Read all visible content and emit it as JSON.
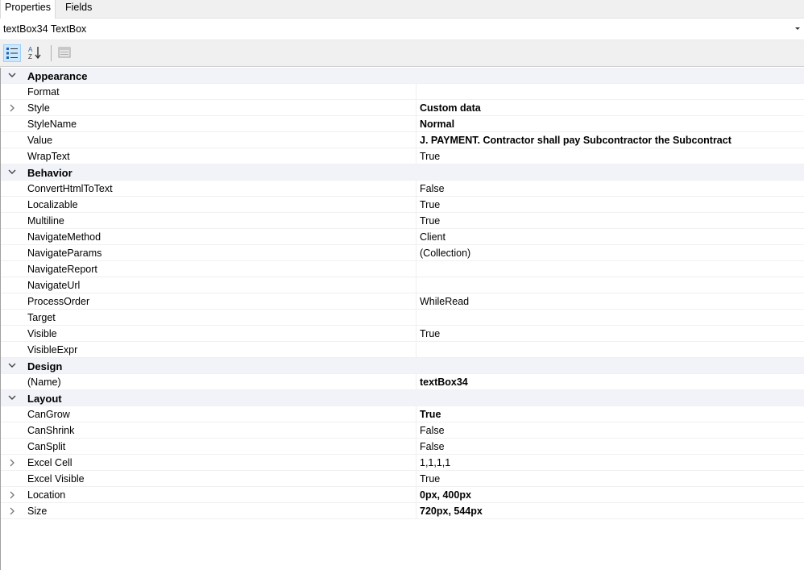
{
  "tabs": [
    "Properties",
    "Fields"
  ],
  "object_selector": {
    "value": "textBox34  TextBox",
    "icon": "chevron-down-icon"
  },
  "toolbar": {
    "buttons": [
      "categorized-icon",
      "alphabetical-sort-icon",
      "property-pages-icon"
    ]
  },
  "grid": {
    "categories": [
      {
        "label": "Appearance",
        "rows": [
          {
            "name": "Format",
            "value": "",
            "bold": false,
            "expandable": false
          },
          {
            "name": "Style",
            "value": "Custom data",
            "bold": true,
            "expandable": true
          },
          {
            "name": "StyleName",
            "value": "Normal",
            "bold": true,
            "expandable": false
          },
          {
            "name": "Value",
            "value": "J.  PAYMENT.  Contractor shall pay Subcontractor the Subcontract",
            "bold": true,
            "expandable": false
          },
          {
            "name": "WrapText",
            "value": "True",
            "bold": false,
            "expandable": false
          }
        ]
      },
      {
        "label": "Behavior",
        "rows": [
          {
            "name": "ConvertHtmlToText",
            "value": "False",
            "bold": false,
            "expandable": false
          },
          {
            "name": "Localizable",
            "value": "True",
            "bold": false,
            "expandable": false
          },
          {
            "name": "Multiline",
            "value": "True",
            "bold": false,
            "expandable": false
          },
          {
            "name": "NavigateMethod",
            "value": "Client",
            "bold": false,
            "expandable": false
          },
          {
            "name": "NavigateParams",
            "value": "(Collection)",
            "bold": false,
            "expandable": false
          },
          {
            "name": "NavigateReport",
            "value": "",
            "bold": false,
            "expandable": false
          },
          {
            "name": "NavigateUrl",
            "value": "",
            "bold": false,
            "expandable": false
          },
          {
            "name": "ProcessOrder",
            "value": "WhileRead",
            "bold": false,
            "expandable": false
          },
          {
            "name": "Target",
            "value": "",
            "bold": false,
            "expandable": false
          },
          {
            "name": "Visible",
            "value": "True",
            "bold": false,
            "expandable": false
          },
          {
            "name": "VisibleExpr",
            "value": "",
            "bold": false,
            "expandable": false
          }
        ]
      },
      {
        "label": "Design",
        "rows": [
          {
            "name": "(Name)",
            "value": "textBox34",
            "bold": true,
            "expandable": false
          }
        ]
      },
      {
        "label": "Layout",
        "rows": [
          {
            "name": "CanGrow",
            "value": "True",
            "bold": true,
            "expandable": false
          },
          {
            "name": "CanShrink",
            "value": "False",
            "bold": false,
            "expandable": false
          },
          {
            "name": "CanSplit",
            "value": "False",
            "bold": false,
            "expandable": false
          },
          {
            "name": "Excel Cell",
            "value": "1,1,1,1",
            "bold": false,
            "expandable": true
          },
          {
            "name": "Excel Visible",
            "value": "True",
            "bold": false,
            "expandable": false
          },
          {
            "name": "Location",
            "value": "0px, 400px",
            "bold": true,
            "expandable": true
          },
          {
            "name": "Size",
            "value": "720px, 544px",
            "bold": true,
            "expandable": true
          }
        ]
      }
    ]
  }
}
